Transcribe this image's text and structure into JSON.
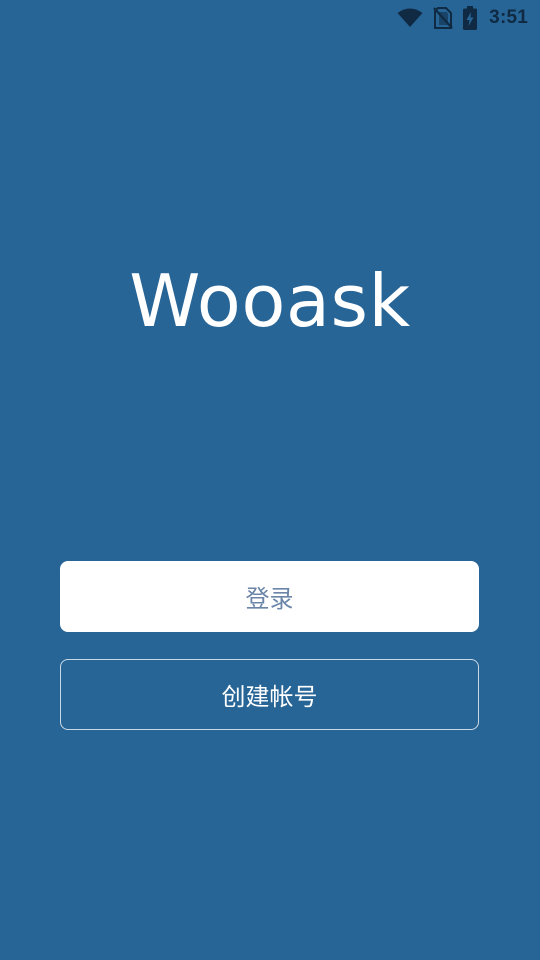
{
  "status_bar": {
    "time": "3:51",
    "icons": [
      "wifi-icon",
      "no-sim-icon",
      "battery-charging-icon"
    ],
    "icon_color": "#0f2a42"
  },
  "app": {
    "title": "Wooask",
    "background_color": "#276597"
  },
  "buttons": {
    "login_label": "登录",
    "register_label": "创建帐号"
  }
}
